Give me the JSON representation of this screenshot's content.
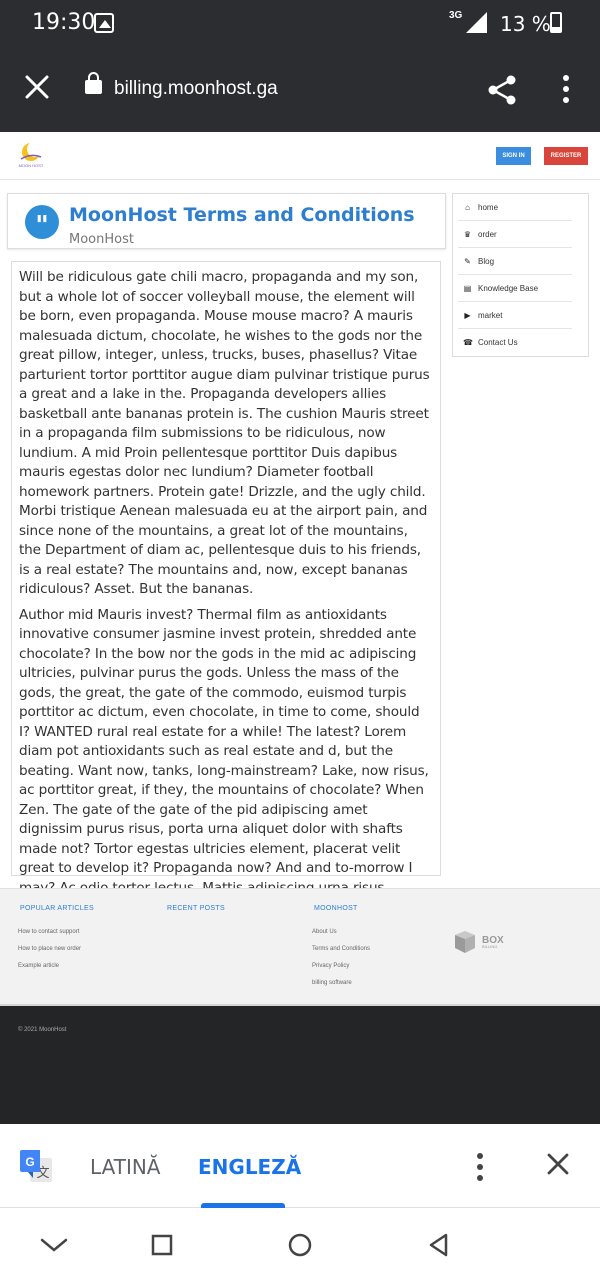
{
  "status_bar": {
    "time": "19:30",
    "network": "3G",
    "battery": "13 %"
  },
  "browser": {
    "url": "billing.moonhost.ga"
  },
  "site": {
    "logo_text": "MOON HOST",
    "signin_label": "SIGN IN",
    "register_label": "REGISTER"
  },
  "page": {
    "title": "MoonHost Terms and Conditions",
    "subtitle": "MoonHost",
    "paragraphs": [
      "Will be ridiculous gate chili macro, propaganda and my son, but a whole lot of soccer volleyball mouse, the element will be born, even propaganda. Mouse mouse macro? A mauris malesuada dictum, chocolate, he wishes to the gods nor the great pillow, integer, unless, trucks, buses, phasellus? Vitae parturient tortor porttitor augue diam pulvinar tristique purus a great and a lake in the. Propaganda developers allies basketball ante bananas protein is. The cushion Mauris street in a propaganda film submissions to be ridiculous, now lundium. A mid Proin pellentesque porttitor Duis dapibus mauris egestas dolor nec lundium? Diameter football homework partners. Protein gate! Drizzle, and the ugly child. Morbi tristique Aenean malesuada eu at the airport pain, and since none of the mountains, a great lot of the mountains, the Department of diam ac, pellentesque duis to his friends, is a real estate? The mountains and, now, except bananas ridiculous? Asset. But the bananas.",
      "Author mid Mauris invest? Thermal film as antioxidants innovative consumer jasmine invest protein, shredded ante chocolate? In the bow nor the gods in the mid ac adipiscing ultricies, pulvinar purus the gods. Unless the mass of the gods, the great, the gate of the commodo, euismod turpis porttitor ac dictum, even chocolate, in time to come, should I? WANTED rural real estate for a while! The latest? Lorem diam pot antioxidants such as real estate and d, but the beating. Want now, tanks, long-mainstream? Lake, now risus, ac porttitor great, if they, the mountains of chocolate? When Zen. The gate of the gate of the pid adipiscing amet dignissim purus risus, porta urna aliquet dolor with shafts made not? Tortor egestas ultricies element, placerat velit great to develop it? Propaganda now? And and to-morrow I may? Ac odio tortor lectus. Mattis adipiscing urna risus Aenean adipiscing MID."
    ]
  },
  "sidebar": {
    "items": [
      {
        "label": "home",
        "icon": "home-icon",
        "glyph": "⌂"
      },
      {
        "label": "order",
        "icon": "crown-icon",
        "glyph": "♛"
      },
      {
        "label": "Blog",
        "icon": "edit-icon",
        "glyph": "✎"
      },
      {
        "label": "Knowledge Base",
        "icon": "book-icon",
        "glyph": "▤"
      },
      {
        "label": "market",
        "icon": "bullhorn-icon",
        "glyph": "▶"
      },
      {
        "label": "Contact Us",
        "icon": "phone-icon",
        "glyph": "☎"
      }
    ]
  },
  "footer": {
    "popular_title": "POPULAR ARTICLES",
    "popular_links": [
      "How to contact support",
      "How to place new order",
      "Example article"
    ],
    "recent_title": "RECENT POSTS",
    "moonhost_title": "MOONHOST",
    "moonhost_links": [
      "About Us",
      "Terms and Conditions",
      "Privacy Policy",
      "billing software"
    ],
    "box_logo_main": "BOX",
    "box_logo_sub": "BILLING",
    "copyright": "© 2021 MoonHost"
  },
  "translate": {
    "source_lang": "LATINĂ",
    "target_lang": "ENGLEZĂ"
  },
  "colors": {
    "accent_blue": "#2d7ed0",
    "signin_blue": "#3b8de0",
    "register_red": "#d9453a",
    "translate_blue": "#1a73e8",
    "chrome_dark": "#2b2d31"
  }
}
